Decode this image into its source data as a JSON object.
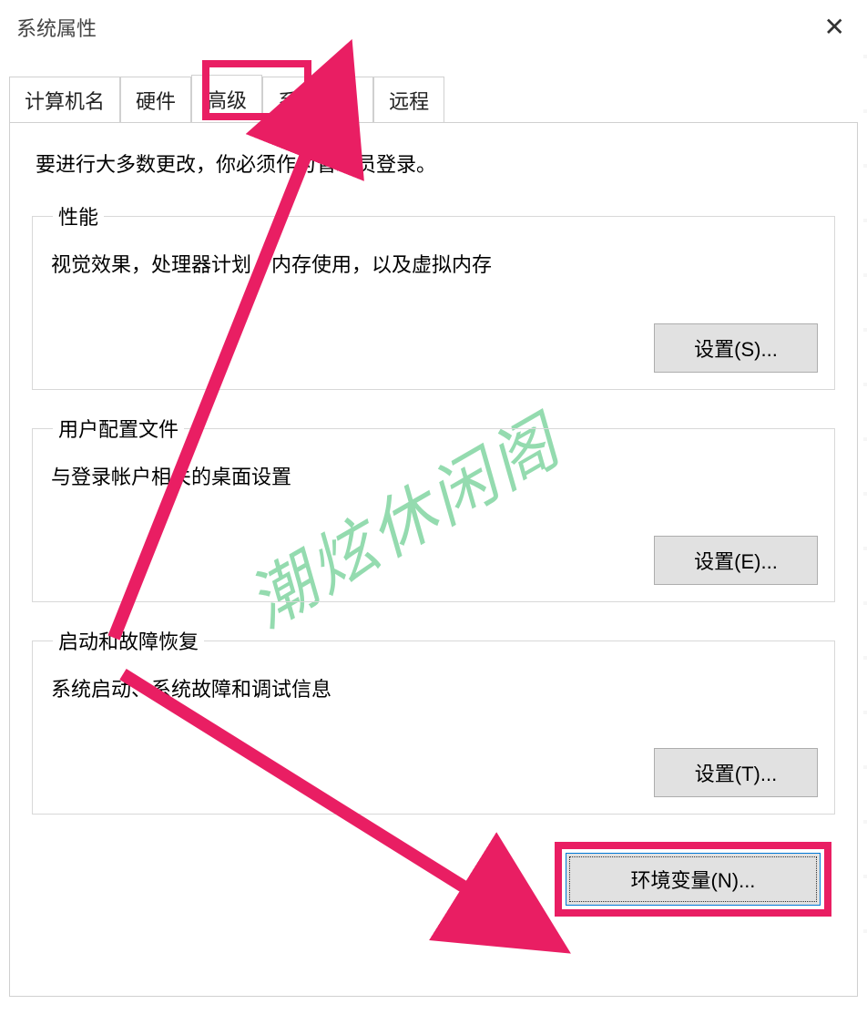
{
  "window": {
    "title": "系统属性"
  },
  "tabs": {
    "computer_name": "计算机名",
    "hardware": "硬件",
    "advanced": "高级",
    "system_protection": "系统保护",
    "remote": "远程"
  },
  "intro": "要进行大多数更改，你必须作为管理员登录。",
  "performance": {
    "legend": "性能",
    "desc": "视觉效果，处理器计划，内存使用，以及虚拟内存",
    "button": "设置(S)..."
  },
  "profiles": {
    "legend": "用户配置文件",
    "desc": "与登录帐户相关的桌面设置",
    "button": "设置(E)..."
  },
  "startup": {
    "legend": "启动和故障恢复",
    "desc": "系统启动、系统故障和调试信息",
    "button": "设置(T)..."
  },
  "env_button": "环境变量(N)...",
  "watermark": "潮炫休闲阁"
}
